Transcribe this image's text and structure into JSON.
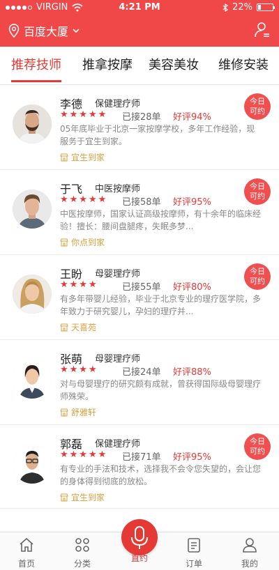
{
  "status": {
    "carrier": "VIRGIN",
    "time": "4:21 PM",
    "battery_text": "22%",
    "battery_level": 0.22
  },
  "header": {
    "location": "百度大厦"
  },
  "tabs": [
    {
      "label": "推荐技师"
    },
    {
      "label": "推拿按摩"
    },
    {
      "label": "美容美妆"
    },
    {
      "label": "维修安装"
    }
  ],
  "technicians": [
    {
      "name": "李德",
      "title": "保健理疗师",
      "stars": "★★★★★",
      "orders": "已接28单",
      "rating": "好评94%",
      "desc": "05年底毕业于北京一家按摩学校，多年工作经验，现服务于宜生到家。",
      "place": "宜生到家",
      "badge_line1": "今日",
      "badge_line2": "可约"
    },
    {
      "name": "于飞",
      "title": "中医按摩师",
      "stars": "★★★★★",
      "orders": "已接58单",
      "rating": "好评95%",
      "desc": "中医按摩师，国家认证高级按摩师，有十余年的临床经验！擅长：腰间盘腿疼，失眠多梦...",
      "place": "你点到家",
      "badge_line1": "今日",
      "badge_line2": "可约"
    },
    {
      "name": "王盼",
      "title": "母婴理疗师",
      "stars": "★★★★",
      "orders": "已接55单",
      "rating": "好评80%",
      "desc": "有多年带婴儿经验，毕业于北京专业的理疗医学院，多年致力于研究婴儿，孕妇的理疗并...",
      "place": "天喜苑",
      "badge_line1": "今日",
      "badge_line2": "可约"
    },
    {
      "name": "张萌",
      "title": "母婴理疗师",
      "stars": "★★★★",
      "orders": "已接24单",
      "rating": "好评88%",
      "desc": "对与母婴理疗的研究颇有成就，曾获得国际级母婴理疗师殊荣。",
      "place": "舒雅轩",
      "badge_line1": "",
      "badge_line2": ""
    },
    {
      "name": "郭磊",
      "title": "保健理疗师",
      "stars": "★★★★★",
      "orders": "已接71单",
      "rating": "好评95%",
      "desc": "有专业的手法和技术，选择我不会令您失望的，会让您的身体得到彻底的放松。",
      "place": "宜生到家",
      "badge_line1": "今日",
      "badge_line2": "可约"
    }
  ],
  "bottom_nav": [
    {
      "label": "首页",
      "icon": "home-icon"
    },
    {
      "label": "分类",
      "icon": "grid-icon"
    },
    {
      "label": "直约",
      "icon": "microphone-icon"
    },
    {
      "label": "订单",
      "icon": "document-icon"
    },
    {
      "label": "我的",
      "icon": "person-icon"
    }
  ],
  "colors": {
    "brand_red": "#f04848",
    "accent_red": "#e53935",
    "place_gold": "#d9a040"
  }
}
